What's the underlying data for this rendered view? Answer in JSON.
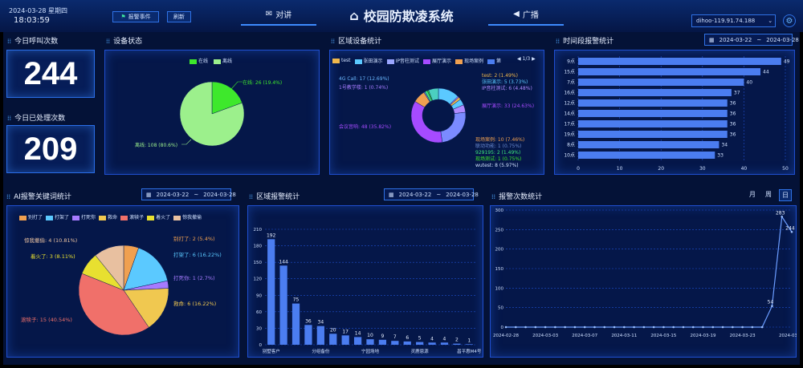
{
  "header": {
    "date": "2024-03-28 星期四",
    "time": "18:03:59",
    "alarm_button": "报警事件",
    "refresh_button": "刷新",
    "talk_label": "对讲",
    "title": "校园防欺凌系统",
    "broadcast_label": "广播",
    "server": "dihoo-119.91.74.188",
    "colors": {
      "accent": "#3d8bff",
      "bar": "#4b7df0",
      "title": "#e8f0ff"
    }
  },
  "calls": {
    "title": "今日呼叫次数",
    "value": "244"
  },
  "handled": {
    "title": "今日已处理次数",
    "value": "209"
  },
  "device_status": {
    "title": "设备状态",
    "legend": [
      "在线",
      "离线"
    ],
    "colors": [
      "#3ee82c",
      "#9cf08c"
    ],
    "labels": [
      "在线: 26 (19.4%)",
      "离线: 108 (80.6%)"
    ],
    "values": [
      26,
      108
    ]
  },
  "region_devices": {
    "title": "区域设备统计",
    "legend": [
      "test",
      "张田演示",
      "IP音柱测试",
      "展厅演示",
      "现场案例",
      "第"
    ],
    "legend_colors": [
      "#f0b84c",
      "#5bc9ff",
      "#9aa6ff",
      "#a64bff",
      "#f0a050",
      "#4b7df0"
    ],
    "page": "1/3",
    "labels": [
      {
        "text": "4G Call: 17 (12.69%)",
        "color": "#6ab8ff"
      },
      {
        "text": "1号教学楼: 1 (0.74%)",
        "color": "#a67bff"
      },
      {
        "text": "test: 2 (1.49%)",
        "color": "#f0b84c"
      },
      {
        "text": "张田演示: 5 (3.73%)",
        "color": "#5bc9ff"
      },
      {
        "text": "IP音柱测试: 6 (4.48%)",
        "color": "#b08bff"
      },
      {
        "text": "展厅演示: 33 (24.63%)",
        "color": "#a64bff"
      },
      {
        "text": "会议音响: 48 (35.82%)",
        "color": "#a64bff"
      },
      {
        "text": "现场案例: 10 (7.46%)",
        "color": "#f0a050"
      },
      {
        "text": "联动功能: 1 (0.75%)",
        "color": "#6a8bd0"
      },
      {
        "text": "929195: 2 (1.49%)",
        "color": "#3ee87c"
      },
      {
        "text": "现场测试: 1 (0.75%)",
        "color": "#3ee82c"
      },
      {
        "text": "wutest: 8 (5.97%)",
        "color": "#cfe0ff"
      }
    ],
    "values": [
      17,
      1,
      2,
      5,
      6,
      33,
      48,
      10,
      1,
      2,
      1,
      8
    ],
    "colors": [
      "#5bc9ff",
      "#a67bff",
      "#f0b84c",
      "#5bc9ff",
      "#b08bff",
      "#7b8bff",
      "#a64bff",
      "#f0a050",
      "#6a8bd0",
      "#3ee87c",
      "#3ee82c",
      "#4bd0c0"
    ]
  },
  "time_alarm": {
    "title": "时间段报警统计",
    "date_from": "2024-03-22",
    "date_sep": "~",
    "date_to": "2024-03-28",
    "chart_data": {
      "type": "bar",
      "orientation": "horizontal",
      "categories": [
        "9点",
        "15点",
        "7点",
        "16点",
        "12点",
        "14点",
        "17点",
        "19点",
        "8点",
        "10点"
      ],
      "values": [
        49,
        44,
        40,
        37,
        36,
        36,
        36,
        36,
        34,
        33
      ],
      "xlim": [
        0,
        50
      ],
      "xticks": [
        "0",
        "10",
        "20",
        "30",
        "40",
        "50"
      ]
    }
  },
  "ai_alarm": {
    "title": "AI报警关键词统计",
    "date_from": "2024-03-22",
    "date_sep": "~",
    "date_to": "2024-03-28",
    "legend": [
      "别打了",
      "打架了",
      "打死你",
      "救命",
      "滚犊子",
      "着火了",
      "惊我撤偷"
    ],
    "legend_colors": [
      "#f0a050",
      "#5bc9ff",
      "#a67bff",
      "#f0c850",
      "#f0706a",
      "#e8e030",
      "#e8c0a0"
    ],
    "labels": [
      {
        "text": "别打了: 2 (5.4%)",
        "color": "#f0a050"
      },
      {
        "text": "打架了: 6 (16.22%)",
        "color": "#5bc9ff"
      },
      {
        "text": "打死你: 1 (2.7%)",
        "color": "#a67bff"
      },
      {
        "text": "救命: 6 (16.22%)",
        "color": "#f0c850"
      },
      {
        "text": "滚犊子: 15 (40.54%)",
        "color": "#f0706a"
      },
      {
        "text": "着火了: 3 (8.11%)",
        "color": "#e8e030"
      },
      {
        "text": "惊我撤偷: 4 (10.81%)",
        "color": "#e8c0a0"
      }
    ],
    "values": [
      2,
      6,
      1,
      6,
      15,
      3,
      4
    ]
  },
  "region_alarm": {
    "title": "区域报警统计",
    "date_from": "2024-03-22",
    "date_sep": "~",
    "date_to": "2024-03-28",
    "chart_data": {
      "type": "bar",
      "values": [
        192,
        144,
        75,
        36,
        34,
        20,
        17,
        14,
        10,
        9,
        7,
        6,
        5,
        4,
        4,
        2,
        1
      ],
      "xlabels": [
        "别墅客户",
        "分组备份",
        "宁园场地",
        "灵鹿恩源",
        "昌平惠M4号"
      ],
      "ylim": [
        0,
        210
      ],
      "yticks": [
        "0",
        "30",
        "60",
        "90",
        "120",
        "150",
        "180",
        "210"
      ]
    }
  },
  "alarm_count": {
    "title": "报警次数统计",
    "tabs": [
      "月",
      "周",
      "日"
    ],
    "chart_data": {
      "type": "line",
      "x": [
        "2024-02-28",
        "2024-02-29",
        "2024-03-01",
        "2024-03-02",
        "2024-03-03",
        "2024-03-04",
        "2024-03-05",
        "2024-03-06",
        "2024-03-07",
        "2024-03-08",
        "2024-03-09",
        "2024-03-10",
        "2024-03-11",
        "2024-03-12",
        "2024-03-13",
        "2024-03-14",
        "2024-03-15",
        "2024-03-16",
        "2024-03-17",
        "2024-03-18",
        "2024-03-19",
        "2024-03-20",
        "2024-03-21",
        "2024-03-22",
        "2024-03-23",
        "2024-03-24",
        "2024-03-25",
        "2024-03-26",
        "2024-03-27",
        "2024-03-28"
      ],
      "values": [
        0,
        0,
        0,
        0,
        0,
        0,
        0,
        0,
        0,
        0,
        0,
        0,
        0,
        0,
        0,
        0,
        0,
        0,
        0,
        0,
        0,
        0,
        0,
        0,
        0,
        0,
        0,
        54,
        283,
        244
      ],
      "point_labels": {
        "27": "54",
        "28": "283",
        "29": "244"
      },
      "xticks": [
        "2024-02-28",
        "2024-03-03",
        "2024-03-07",
        "2024-03-11",
        "2024-03-15",
        "2024-03-19",
        "2024-03-23",
        "2024-03-28"
      ],
      "ylim": [
        0,
        300
      ],
      "yticks": [
        "0",
        "50",
        "100",
        "150",
        "200",
        "250",
        "300"
      ]
    }
  }
}
